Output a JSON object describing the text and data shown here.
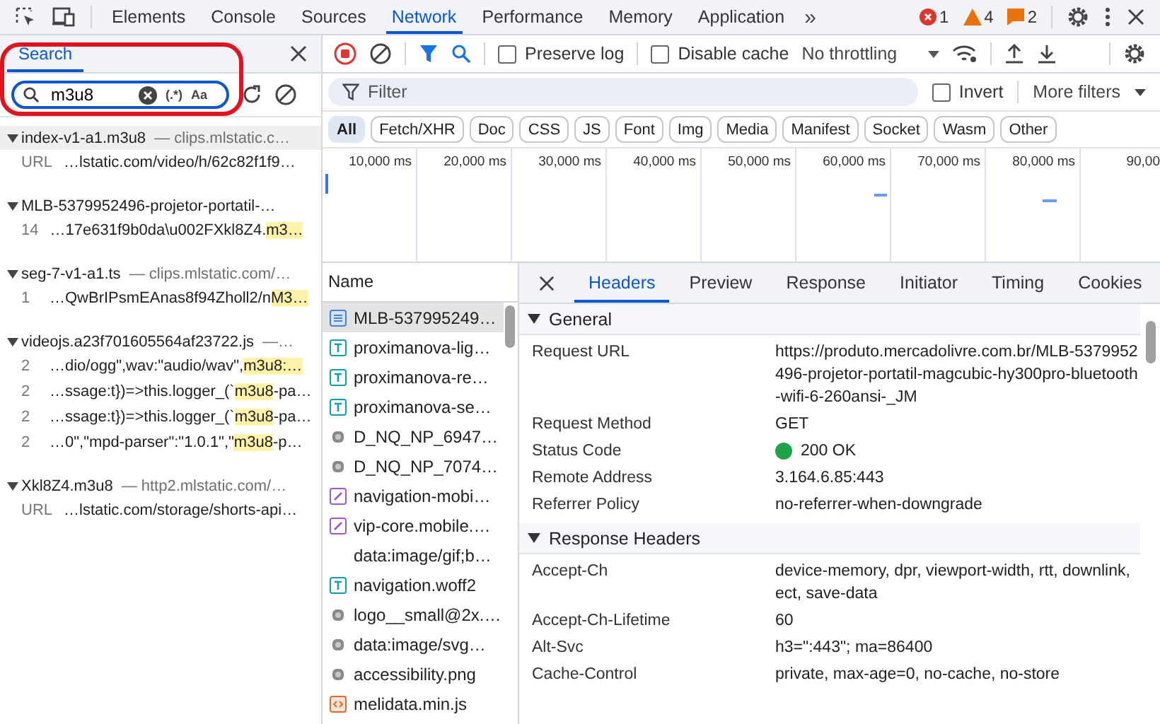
{
  "top_tabs": [
    {
      "label": "Elements",
      "selected": false
    },
    {
      "label": "Console",
      "selected": false
    },
    {
      "label": "Sources",
      "selected": false
    },
    {
      "label": "Network",
      "selected": true
    },
    {
      "label": "Performance",
      "selected": false
    },
    {
      "label": "Memory",
      "selected": false
    },
    {
      "label": "Application",
      "selected": false
    }
  ],
  "more_tabs": "»",
  "counters": [
    {
      "kind": "error",
      "count": "1"
    },
    {
      "kind": "warning",
      "count": "4"
    },
    {
      "kind": "issue",
      "count": "2"
    }
  ],
  "search_panel": {
    "title": "Search",
    "query": "m3u8",
    "regex_toggle": "(.*)",
    "case_toggle": "Aa",
    "groups": [
      {
        "file": "index-v1-a1.m3u8",
        "source": "— clips.mlstatic.c…",
        "expanded": true,
        "selected": true,
        "matches": [
          {
            "line": "URL",
            "segments": [
              {
                "text": "…lstatic.com/video/h/62c82f1f9…",
                "highlight": false
              }
            ]
          }
        ]
      },
      {
        "file": "MLB-5379952496-projetor-portatil-…",
        "expanded": true,
        "selected": false,
        "matches": [
          {
            "line": "14",
            "segments": [
              {
                "text": "…17e631f9b0da\\u002FXkl8Z4.",
                "highlight": false
              },
              {
                "text": "m3…",
                "highlight": true
              }
            ]
          }
        ]
      },
      {
        "file": "seg-7-v1-a1.ts",
        "source": "— clips.mlstatic.com/…",
        "expanded": true,
        "selected": false,
        "matches": [
          {
            "line": "1",
            "segments": [
              {
                "text": "…QwBrIPsmEAnas8f94Zholl2/n",
                "highlight": false
              },
              {
                "text": "M3…",
                "highlight": true
              }
            ]
          }
        ]
      },
      {
        "file": "videojs.a23f701605564af23722.js",
        "source": "—…",
        "expanded": true,
        "selected": false,
        "matches": [
          {
            "line": "2",
            "segments": [
              {
                "text": "…dio/ogg\",wav:\"audio/wav\",",
                "highlight": false
              },
              {
                "text": "m3u8:…",
                "highlight": true
              }
            ]
          },
          {
            "line": "2",
            "segments": [
              {
                "text": "…ssage:t})=>this.logger_(`",
                "highlight": false
              },
              {
                "text": "m3u8",
                "highlight": true
              },
              {
                "text": "-pa…",
                "highlight": false
              }
            ]
          },
          {
            "line": "2",
            "segments": [
              {
                "text": "…ssage:t})=>this.logger_(`",
                "highlight": false
              },
              {
                "text": "m3u8",
                "highlight": true
              },
              {
                "text": "-pa…",
                "highlight": false
              }
            ]
          },
          {
            "line": "2",
            "segments": [
              {
                "text": "…0\",\"mpd-parser\":\"1.0.1\",\"",
                "highlight": false
              },
              {
                "text": "m3u8",
                "highlight": true
              },
              {
                "text": "-p…",
                "highlight": false
              }
            ]
          }
        ]
      },
      {
        "file": "Xkl8Z4.m3u8",
        "source": "— http2.mlstatic.com/…",
        "expanded": true,
        "selected": false,
        "matches": [
          {
            "line": "URL",
            "segments": [
              {
                "text": "…lstatic.com/storage/shorts-api…",
                "highlight": false
              }
            ]
          }
        ]
      }
    ]
  },
  "toolbar": {
    "recording": true,
    "filter_active": true,
    "preserve_log": {
      "label": "Preserve log",
      "checked": false
    },
    "disable_cache": {
      "label": "Disable cache",
      "checked": false
    },
    "throttling": "No throttling"
  },
  "filter": {
    "placeholder": "Filter",
    "invert": {
      "label": "Invert",
      "checked": false
    },
    "more_filters": "More filters"
  },
  "type_filters": [
    {
      "label": "All",
      "selected": true
    },
    {
      "label": "Fetch/XHR",
      "selected": false
    },
    {
      "label": "Doc",
      "selected": false
    },
    {
      "label": "CSS",
      "selected": false
    },
    {
      "label": "JS",
      "selected": false
    },
    {
      "label": "Font",
      "selected": false
    },
    {
      "label": "Img",
      "selected": false
    },
    {
      "label": "Media",
      "selected": false
    },
    {
      "label": "Manifest",
      "selected": false
    },
    {
      "label": "Socket",
      "selected": false
    },
    {
      "label": "Wasm",
      "selected": false
    },
    {
      "label": "Other",
      "selected": false
    }
  ],
  "overview_ticks": [
    "10,000 ms",
    "20,000 ms",
    "30,000 ms",
    "40,000 ms",
    "50,000 ms",
    "60,000 ms",
    "70,000 ms",
    "80,000 ms",
    "90,00"
  ],
  "requests": {
    "column": "Name",
    "rows": [
      {
        "name": "MLB-537995249…",
        "kind": "document",
        "selected": true
      },
      {
        "name": "proximanova-lig…",
        "kind": "font",
        "selected": false
      },
      {
        "name": "proximanova-re…",
        "kind": "font",
        "selected": false
      },
      {
        "name": "proximanova-se…",
        "kind": "font",
        "selected": false
      },
      {
        "name": "D_NQ_NP_6947…",
        "kind": "image",
        "selected": false
      },
      {
        "name": "D_NQ_NP_7074…",
        "kind": "image",
        "selected": false
      },
      {
        "name": "navigation-mobi…",
        "kind": "stylesheet",
        "selected": false
      },
      {
        "name": "vip-core.mobile.…",
        "kind": "stylesheet",
        "selected": false
      },
      {
        "name": "data:image/gif;b…",
        "kind": "blank",
        "selected": false
      },
      {
        "name": "navigation.woff2",
        "kind": "font",
        "selected": false
      },
      {
        "name": "logo__small@2x.…",
        "kind": "image",
        "selected": false
      },
      {
        "name": "data:image/svg…",
        "kind": "image",
        "selected": false
      },
      {
        "name": "accessibility.png",
        "kind": "image",
        "selected": false
      },
      {
        "name": "melidata.min.js",
        "kind": "script",
        "selected": false
      }
    ]
  },
  "details": {
    "tabs": [
      {
        "label": "Headers",
        "selected": true
      },
      {
        "label": "Preview",
        "selected": false
      },
      {
        "label": "Response",
        "selected": false
      },
      {
        "label": "Initiator",
        "selected": false
      },
      {
        "label": "Timing",
        "selected": false
      },
      {
        "label": "Cookies",
        "selected": false
      }
    ],
    "sections": [
      {
        "title": "General",
        "expanded": true,
        "rows": [
          {
            "name": "Request URL",
            "value": "https://produto.mercadolivre.com.br/MLB-5379952496-projetor-portatil-magcubic-hy300pro-bluetooth-wifi-6-260ansi-_JM"
          },
          {
            "name": "Request Method",
            "value": "GET"
          },
          {
            "name": "Status Code",
            "value": "200 OK",
            "color": "#1ea446"
          },
          {
            "name": "Remote Address",
            "value": "3.164.6.85:443"
          },
          {
            "name": "Referrer Policy",
            "value": "no-referrer-when-downgrade"
          }
        ]
      },
      {
        "title": "Response Headers",
        "expanded": true,
        "rows": [
          {
            "name": "Accept-Ch",
            "value": "device-memory, dpr, viewport-width, rtt, downlink, ect, save-data"
          },
          {
            "name": "Accept-Ch-Lifetime",
            "value": "60"
          },
          {
            "name": "Alt-Svc",
            "value": "h3=\":443\"; ma=86400"
          },
          {
            "name": "Cache-Control",
            "value": "private, max-age=0, no-cache, no-store"
          }
        ]
      }
    ]
  }
}
